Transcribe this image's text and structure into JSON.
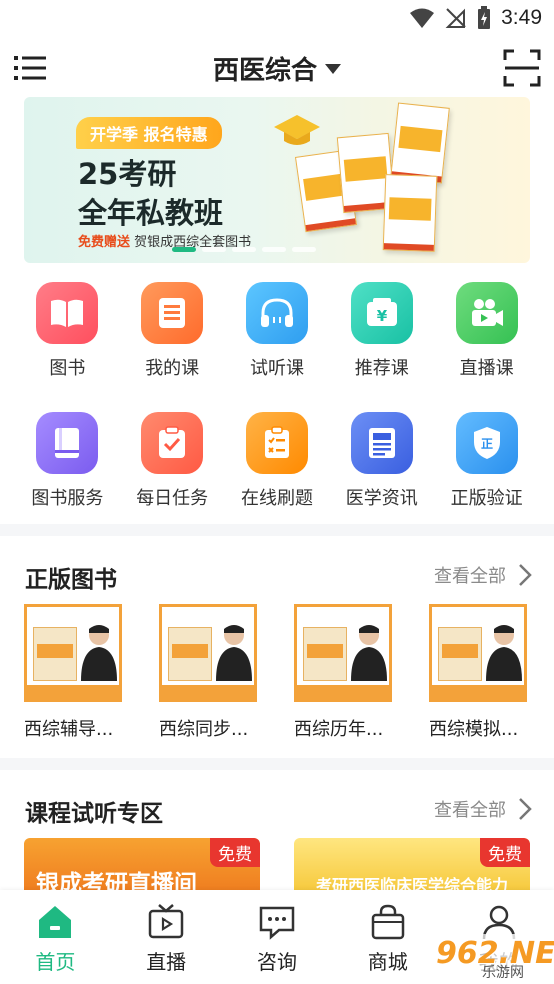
{
  "status_bar": {
    "time": "3:49"
  },
  "header": {
    "title": "西医综合"
  },
  "banner": {
    "tag": "开学季 报名特惠",
    "title_line1": "25考研",
    "title_line2": "全年私教班",
    "subtitle_highlight": "免费赠送",
    "subtitle_rest": " 贺银成西综全套图书",
    "page_indicator": {
      "count": 5,
      "active": 1
    }
  },
  "grid_row1": [
    {
      "label": "图书",
      "icon": "book-open-icon",
      "color": "#ff5d6b"
    },
    {
      "label": "我的课",
      "icon": "document-list-icon",
      "color": "#ff7a3d"
    },
    {
      "label": "试听课",
      "icon": "headphones-icon",
      "color": "#3eb2f5"
    },
    {
      "label": "推荐课",
      "icon": "yen-wallet-icon",
      "color": "#2fd0b6"
    },
    {
      "label": "直播课",
      "icon": "video-camera-icon",
      "color": "#4ed16b"
    }
  ],
  "grid_row2": [
    {
      "label": "图书服务",
      "icon": "notebook-icon",
      "color": "#8f72f2"
    },
    {
      "label": "每日任务",
      "icon": "task-check-icon",
      "color": "#ff6c55"
    },
    {
      "label": "在线刷题",
      "icon": "clipboard-quiz-icon",
      "color": "#ff9b1f"
    },
    {
      "label": "医学资讯",
      "icon": "news-icon",
      "color": "#4c72ea"
    },
    {
      "label": "正版验证",
      "icon": "shield-verify-icon",
      "color": "#3fa5f5"
    }
  ],
  "books_section": {
    "title": "正版图书",
    "see_all": "查看全部",
    "items": [
      {
        "name": "西综辅导..."
      },
      {
        "name": "西综同步..."
      },
      {
        "name": "西综历年..."
      },
      {
        "name": "西综模拟..."
      }
    ]
  },
  "courses_section": {
    "title": "课程试听专区",
    "see_all": "查看全部",
    "items": [
      {
        "text": "银成考研直播间",
        "badge": "免费"
      },
      {
        "text": "考研西医临床医学综合能力",
        "badge": "免费"
      }
    ]
  },
  "bottom_nav": [
    {
      "label": "首页",
      "icon": "home-icon",
      "active": true
    },
    {
      "label": "直播",
      "icon": "tv-icon",
      "active": false
    },
    {
      "label": "咨询",
      "icon": "chat-icon",
      "active": false
    },
    {
      "label": "商城",
      "icon": "shopping-bag-icon",
      "active": false
    },
    {
      "label": "我的",
      "icon": "user-icon",
      "active": false
    }
  ],
  "watermark": {
    "main": "962.NET",
    "sub": "乐游网"
  },
  "colors": {
    "accent": "#1fb982",
    "badge": "#e8362f"
  }
}
